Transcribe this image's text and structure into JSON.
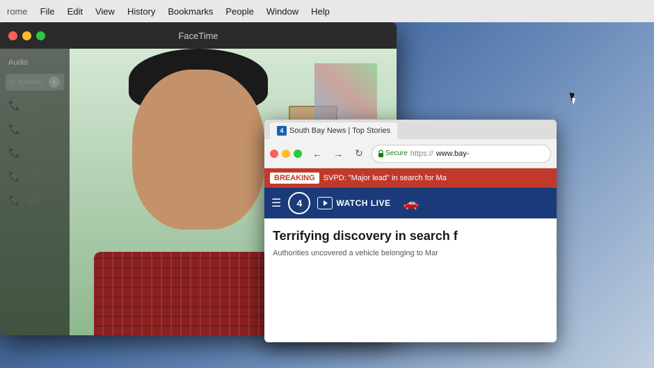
{
  "menubar": {
    "items": [
      {
        "id": "chrome-partial",
        "label": "rome"
      },
      {
        "id": "file",
        "label": "File"
      },
      {
        "id": "edit",
        "label": "Edit"
      },
      {
        "id": "view",
        "label": "View"
      },
      {
        "id": "history",
        "label": "History"
      },
      {
        "id": "bookmarks",
        "label": "Bookmarks"
      },
      {
        "id": "people",
        "label": "People"
      },
      {
        "id": "window",
        "label": "Window"
      },
      {
        "id": "help",
        "label": "Help"
      }
    ]
  },
  "facetime": {
    "title": "FaceTime",
    "sidebar": {
      "audio_label": "Audio",
      "input_placeholder": "or number",
      "contacts": [
        {},
        {},
        {},
        {},
        {}
      ]
    }
  },
  "chrome": {
    "tab_title": "South Bay News | Top Stories",
    "favicon_label": "4",
    "nav": {
      "back": "←",
      "forward": "→",
      "reload": "↻"
    },
    "addressbar": {
      "secure_text": "Secure",
      "url_prefix": "https://",
      "url_domain": "www.bay-"
    },
    "breaking": {
      "label": "BREAKING",
      "text": "SVPD: \"Major lead\" in search for Ma"
    },
    "navbar": {
      "watch_live": "WATCH LIVE",
      "logo_label": "4"
    },
    "article": {
      "headline": "Terrifying discovery in search f",
      "subtext": "Authorities uncovered a vehicle belonging to Mar"
    }
  }
}
